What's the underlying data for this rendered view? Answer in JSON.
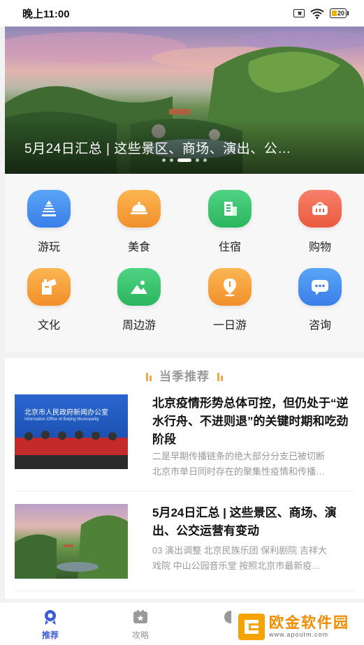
{
  "status_bar": {
    "time": "晚上11:00",
    "battery": "20"
  },
  "banner": {
    "title": "5月24日汇总 | 这些景区、商场、演出、公…",
    "dot_count": 5,
    "active_dot": 2
  },
  "menu": {
    "items": [
      {
        "label": "游玩",
        "icon": "temple-icon",
        "color": "#4a90f0"
      },
      {
        "label": "美食",
        "icon": "food-cloche-icon",
        "color": "#f7a23b"
      },
      {
        "label": "住宿",
        "icon": "building-icon",
        "color": "#3cc46e"
      },
      {
        "label": "购物",
        "icon": "shopping-basket-icon",
        "color": "#f06a4e"
      },
      {
        "label": "文化",
        "icon": "culture-icon",
        "color": "#f7a23b"
      },
      {
        "label": "周边游",
        "icon": "mountain-icon",
        "color": "#3cc46e"
      },
      {
        "label": "一日游",
        "icon": "location-pin-icon",
        "color": "#f7a23b"
      },
      {
        "label": "咨询",
        "icon": "chat-icon",
        "color": "#4a90f0"
      }
    ]
  },
  "recommend": {
    "title": "当季推荐",
    "articles": [
      {
        "title": "北京疫情形势总体可控，但仍处于“逆水行舟、不进则退”的关键时期和吃劲阶段",
        "desc_line1": "二是早期传播链条的绝大部分分支已被切断",
        "desc_line2": "北京市单日同时存在的聚集性疫情和传播…",
        "thumb_text_cn": "北京市人民政府新闻办公室",
        "thumb_text_en": "Information Office of Beijing Municipality"
      },
      {
        "title": "5月24日汇总 | 这些景区、商场、演出、公交运营有变动",
        "desc_line1": "03 演出调整 北京民族乐团 保利剧院 吉祥大",
        "desc_line2": "戏院 中山公园音乐堂 按照北京市最新疫…"
      }
    ]
  },
  "tab_bar": {
    "tabs": [
      {
        "label": "推荐",
        "active": true
      },
      {
        "label": "攻略",
        "active": false
      },
      {
        "label": "",
        "active": false
      },
      {
        "label": "",
        "active": false
      }
    ]
  },
  "watermark": {
    "text": "欧金软件园",
    "url": "www.apoutm.com"
  },
  "colors": {
    "accent_blue": "#3a5bd6",
    "section_bar": "#f2a54a"
  }
}
